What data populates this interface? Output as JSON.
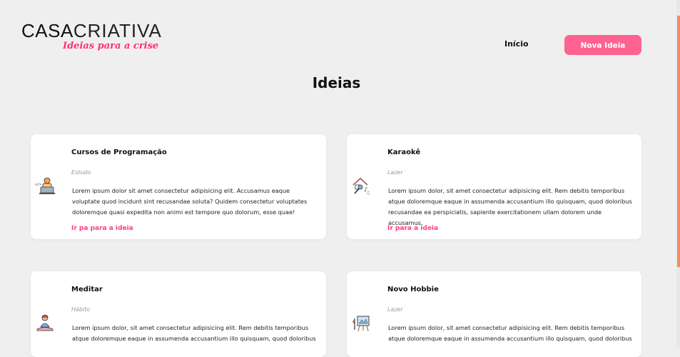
{
  "logo": {
    "main_bold": "CASA",
    "main_thin": "CRIATIVA",
    "tagline": "Ideias para a crise"
  },
  "nav": {
    "home": "Início",
    "new_idea": "Nova Ideia"
  },
  "page": {
    "title": "Ideias"
  },
  "cards": [
    {
      "title": "Cursos de Programação",
      "category": "Estudo",
      "description": "Lorem ipsum dolor sit amet consectetur adipisicing elit. Accusamus eaque voluptate quod incidunt sint recusandae soluta? Quidem consectetur voluptates doloremque quasi expedita non animi est tempore quo dolorum, esse quae!",
      "link": "Ir pa para a ideia",
      "icon": "programmer-icon"
    },
    {
      "title": "Karaokê",
      "category": "Lazer",
      "description": "Lorem ipsum dolor, sit amet consectetur adipisicing elit. Rem debitis temporibus atque doloremque eaque in assumenda accusantium illo quisquam, quod doloribus recusandae ea perspiciatis, sapiente exercitationem ullam dolorem unde accusamus.",
      "link": "Ir para a ideia",
      "icon": "karaoke-house-icon"
    },
    {
      "title": "Meditar",
      "category": "Hábito",
      "description": "Lorem ipsum dolor, sit amet consectetur adipisicing elit. Rem debitis temporibus atque doloremque eaque in assumenda accusantium illo quisquam, quod doloribus",
      "link": "",
      "icon": "meditation-icon"
    },
    {
      "title": "Novo Hobbie",
      "category": "Lazer",
      "description": "Lorem ipsum dolor, sit amet consectetur adipisicing elit. Rem debitis temporibus atque doloremque eaque in assumenda accusantium illo quisquam, quod doloribus",
      "link": "",
      "icon": "easel-painting-icon"
    }
  ],
  "colors": {
    "accent": "#fe6291",
    "link": "#ff3d7f",
    "background": "#efefef",
    "scrollbar": "#f58b5f"
  }
}
